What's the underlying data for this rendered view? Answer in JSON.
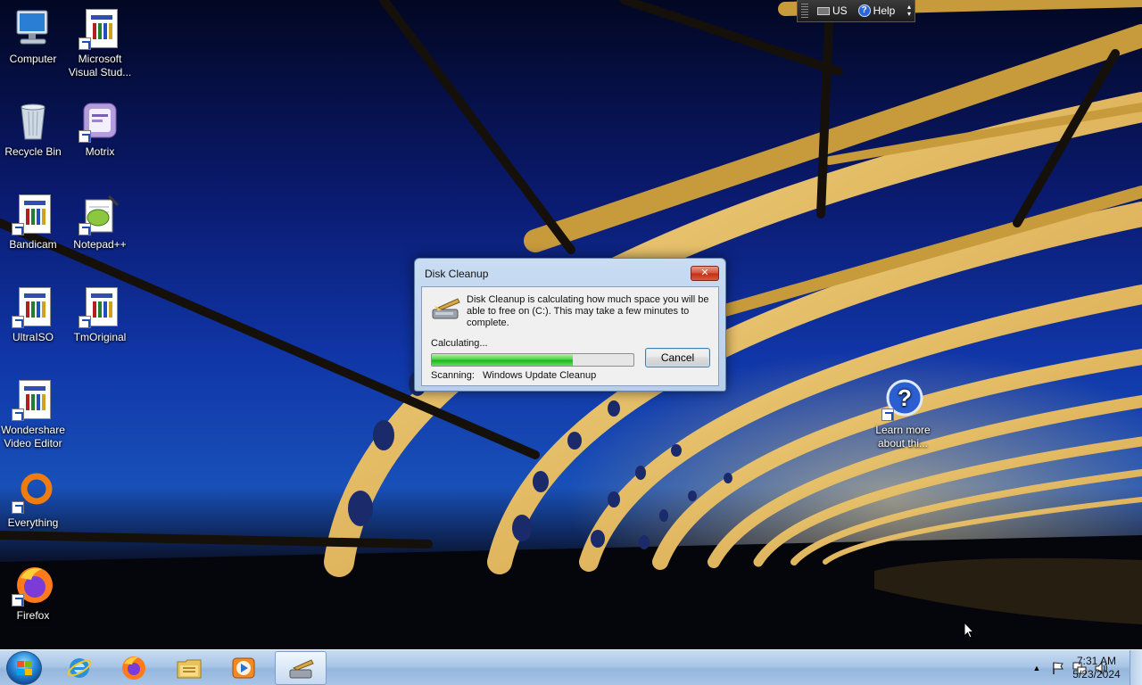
{
  "desktop": {
    "icons": [
      {
        "label": "Computer"
      },
      {
        "label": "Microsoft Visual Stud..."
      },
      {
        "label": "Recycle Bin"
      },
      {
        "label": "Motrix"
      },
      {
        "label": "Bandicam"
      },
      {
        "label": "Notepad++"
      },
      {
        "label": "UltraISO"
      },
      {
        "label": "TmOriginal"
      },
      {
        "label": "Wondershare Video Editor"
      },
      {
        "label": "Everything"
      },
      {
        "label": "Firefox"
      },
      {
        "label": "Learn more about thi..."
      }
    ]
  },
  "language_bar": {
    "language": "US",
    "help_label": "Help",
    "help_glyph": "?"
  },
  "dialog": {
    "title": "Disk Cleanup",
    "close_glyph": "✕",
    "message": "Disk Cleanup is calculating how much space you will be able to free on  (C:). This may take a few minutes to complete.",
    "status": "Calculating...",
    "progress_fraction": 0.7,
    "cancel_label": "Cancel",
    "scan_label": "Scanning:",
    "scan_value": "Windows Update Cleanup"
  },
  "taskbar": {
    "pinned": [
      {
        "name": "Internet Explorer",
        "icon": "ie-icon"
      },
      {
        "name": "Firefox",
        "icon": "firefox-icon"
      },
      {
        "name": "Windows Explorer",
        "icon": "folder-icon"
      },
      {
        "name": "Windows Media Player",
        "icon": "media-player-icon"
      },
      {
        "name": "Disk Cleanup",
        "icon": "disk-cleanup-icon",
        "active": true
      }
    ],
    "tray": {
      "chevron": "▲",
      "icons": [
        "action-center-flag-icon",
        "network-icon",
        "volume-icon"
      ]
    },
    "clock": {
      "time": "7:31 AM",
      "date": "5/23/2024"
    }
  }
}
